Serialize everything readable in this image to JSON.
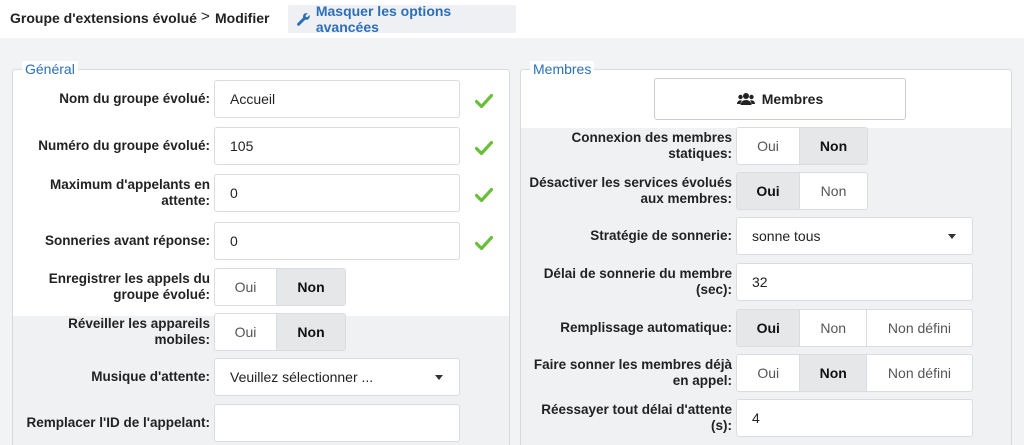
{
  "breadcrumb": {
    "parent": "Groupe d'extensions évolué",
    "separator": ">",
    "current": "Modifier"
  },
  "toolbar": {
    "advanced_label": "Masquer les options avancées",
    "advanced_icon": "wrench-icon"
  },
  "general": {
    "legend": "Général",
    "fields": {
      "name_label": "Nom du groupe évolué:",
      "name_value": "Accueil",
      "number_label": "Numéro du groupe évolué:",
      "number_value": "105",
      "max_label": "Maximum d'appelants en attente:",
      "max_value": "0",
      "rings_label": "Sonneries avant réponse:",
      "rings_value": "0",
      "record_label": "Enregistrer les appels du groupe évolué:",
      "wake_label": "Réveiller les appareils mobiles:",
      "moh_label": "Musique d'attente:",
      "moh_value": "Veuillez sélectionner ...",
      "cid_label": "Remplacer l'ID de l'appelant:",
      "cid_value": ""
    },
    "toggles": {
      "record": {
        "oui": "Oui",
        "non": "Non",
        "selected": "Non"
      },
      "wake": {
        "oui": "Oui",
        "non": "Non",
        "selected": "Non"
      }
    }
  },
  "members": {
    "legend": "Membres",
    "button_label": "Membres",
    "button_icon": "users-icon",
    "fields": {
      "static_label": "Connexion des membres statiques:",
      "disable_label": "Désactiver les services évolués aux membres:",
      "strategy_label": "Stratégie de sonnerie:",
      "strategy_value": "sonne tous",
      "delay_label": "Délai de sonnerie du membre (sec):",
      "delay_value": "32",
      "autofill_label": "Remplissage automatique:",
      "ringbusy_label": "Faire sonner les membres déjà en appel:",
      "retry_label": "Réessayer tout délai d'attente (s):",
      "retry_value": "4"
    },
    "toggles": {
      "static": {
        "oui": "Oui",
        "non": "Non",
        "selected": "Non"
      },
      "disable": {
        "oui": "Oui",
        "non": "Non",
        "selected": "Oui"
      },
      "autofill": {
        "oui": "Oui",
        "non": "Non",
        "undef": "Non défini",
        "selected": "Oui"
      },
      "ringbusy": {
        "oui": "Oui",
        "non": "Non",
        "undef": "Non défini",
        "selected": "Non"
      }
    }
  },
  "colors": {
    "accent": "#2c6fb8",
    "check": "#6abf3a",
    "selected_toggle": "#e6e7e9"
  }
}
